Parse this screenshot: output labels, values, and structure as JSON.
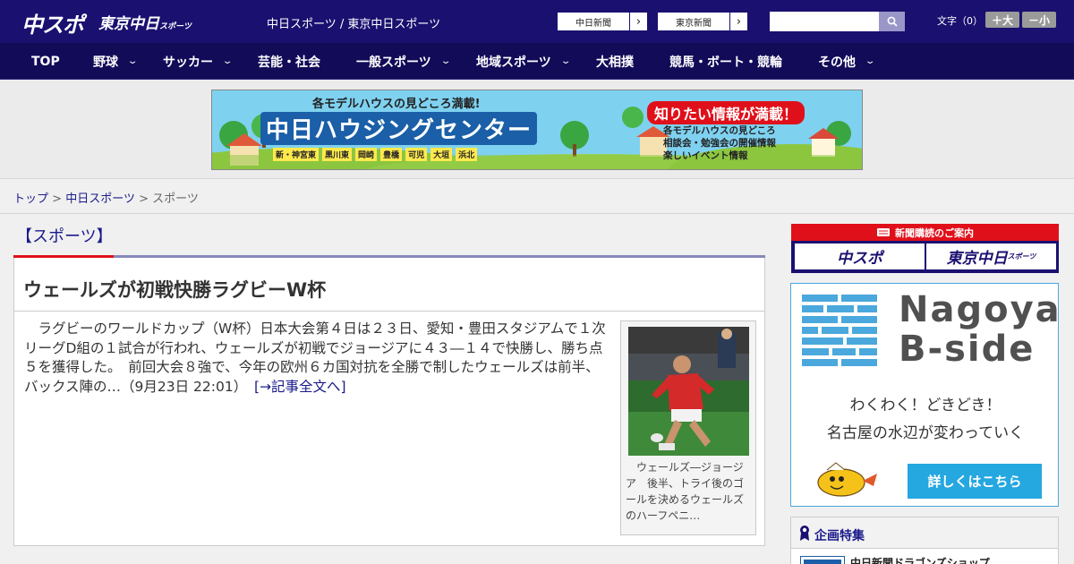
{
  "header": {
    "logo_main": "中スポ",
    "logo_tokyo": "東京中日",
    "logo_tokyo_suffix": "スポーツ",
    "site_title": "中日スポーツ / 東京中日スポーツ",
    "link_chunichi": "中日新聞",
    "link_tokyo": "東京新聞",
    "arrow": "›",
    "search_placeholder": "",
    "font_size_label": "文字（0）",
    "font_larger": "＋大",
    "font_smaller": "－小"
  },
  "nav": {
    "chevron": "⌄",
    "items": [
      "TOP",
      "野球",
      "サッカー",
      "芸能・社会",
      "一般スポーツ",
      "地域スポーツ",
      "大相撲",
      "競馬・ボート・競輪",
      "その他"
    ]
  },
  "ad_banner": {
    "headline_small": "各モデルハウスの見どころ満載!",
    "headline_main": "中日ハウジングセンター",
    "sub_headline": "知りたい情報が満載！",
    "bullets": [
      "各モデルハウスの見どころ",
      "相談会・勉強会の開催情報",
      "楽しいイベント情報"
    ],
    "locations": [
      "新・神宮東",
      "黒川東",
      "岡崎",
      "豊橋",
      "可児",
      "大垣",
      "浜北"
    ]
  },
  "breadcrumb": {
    "home": "トップ",
    "sep": ">",
    "parent": "中日スポーツ",
    "current": "スポーツ"
  },
  "main": {
    "section_title": "【スポーツ】",
    "article": {
      "title": "ウェールズが初戦快勝ラグビーW杯",
      "body": "　ラグビーのワールドカップ（W杯）日本大会第４日は２３日、愛知・豊田スタジアムで１次リーグD組の１試合が行われ、ウェールズが初戦でジョージアに４３―１４で快勝し、勝ち点５を獲得した。　前回大会８強で、今年の欧州６カ国対抗を全勝で制したウェールズは前半、バックス陣の…（9月23日 22:01）　",
      "read_more": "[→記事全文へ]",
      "photo_caption": "　ウェールズ―ジョージア　後半、トライ後のゴールを決めるウェールズのハーフペニ…"
    }
  },
  "sidebar": {
    "subscribe_header": "新聞購読のご案内",
    "subscribe_chuspo": "中スポ",
    "subscribe_tokyo": "東京中日",
    "subscribe_tokyo_suffix": "スポーツ",
    "nagoya_ad": {
      "title1": "Nagoya",
      "title2": "B-side",
      "line1": "わくわく！どきどき！",
      "line2": "名古屋の水辺が変わっていく",
      "cta": "詳しくはこちら"
    },
    "feature": {
      "title": "企画特集",
      "item": "中日新聞ドラゴンズショップ"
    }
  },
  "colors": {
    "header_bg": "#1a1070",
    "nav_bg": "#120b58",
    "accent_red": "#e0101a",
    "link": "#1a1a8a",
    "cta_blue": "#25a7e0"
  }
}
